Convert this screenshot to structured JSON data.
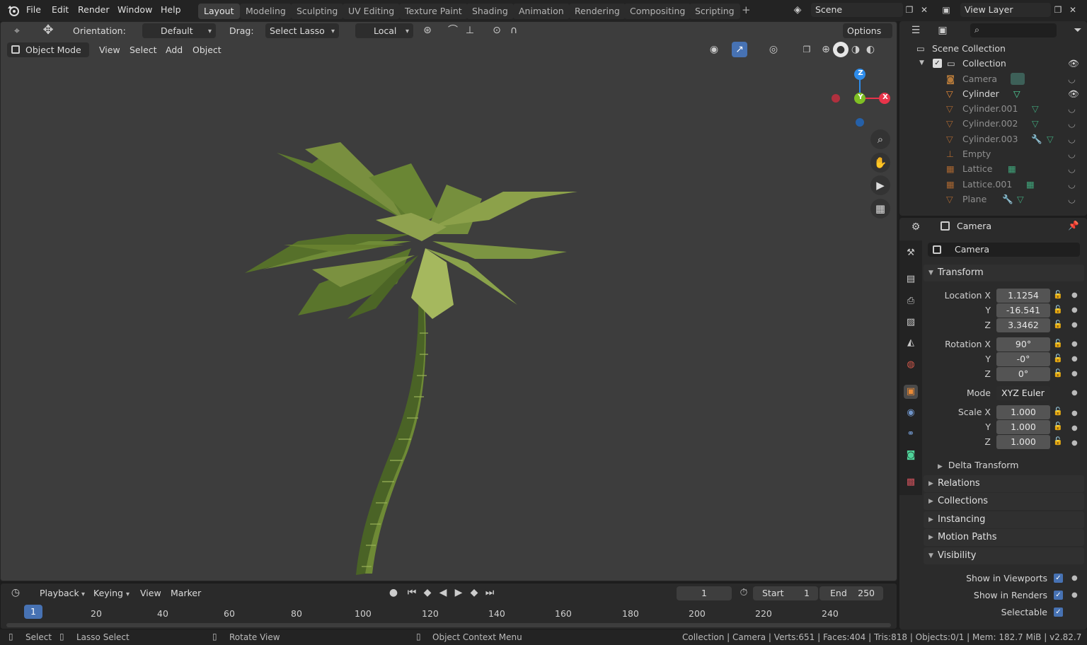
{
  "topbar": {
    "menus": [
      "File",
      "Edit",
      "Render",
      "Window",
      "Help"
    ],
    "workspaces": [
      {
        "label": "Layout",
        "active": true
      },
      {
        "label": "Modeling"
      },
      {
        "label": "Sculpting"
      },
      {
        "label": "UV Editing"
      },
      {
        "label": "Texture Paint"
      },
      {
        "label": "Shading"
      },
      {
        "label": "Animation"
      },
      {
        "label": "Rendering"
      },
      {
        "label": "Compositing"
      },
      {
        "label": "Scripting"
      }
    ],
    "add_tab": "+",
    "scene": "Scene",
    "view_layer": "View Layer"
  },
  "tool_header": {
    "orientation_label": "Orientation:",
    "orientation_value": "Default",
    "drag_label": "Drag:",
    "drag_value": "Select Lasso",
    "pivot_value": "Local",
    "options": "Options"
  },
  "viewport_header": {
    "mode": "Object Mode",
    "menus": [
      "View",
      "Select",
      "Add",
      "Object"
    ]
  },
  "gizmo": {
    "z": "Z",
    "y": "Y",
    "x": "X",
    "colors": {
      "x": "#e8344a",
      "y": "#7fbf24",
      "z": "#2d8ceb"
    }
  },
  "timeline": {
    "menus": [
      "Playback",
      "Keying",
      "View",
      "Marker"
    ],
    "current_frame": "1",
    "start_label": "Start",
    "start": "1",
    "end_label": "End",
    "end": "250",
    "ticks": [
      "20",
      "40",
      "60",
      "80",
      "100",
      "120",
      "140",
      "160",
      "180",
      "200",
      "220",
      "240"
    ],
    "playhead": "1"
  },
  "statusbar": {
    "select": "Select",
    "lasso": "Lasso Select",
    "rotate": "Rotate View",
    "context": "Object Context Menu",
    "stats": "Collection | Camera | Verts:651 | Faces:404 | Tris:818 | Objects:0/1 | Mem: 182.7 MiB | v2.82.7"
  },
  "outliner": {
    "scene_collection": "Scene Collection",
    "collection": "Collection",
    "items": [
      {
        "name": "Camera",
        "dim": true
      },
      {
        "name": "Cylinder",
        "dim": false
      },
      {
        "name": "Cylinder.001",
        "dim": true
      },
      {
        "name": "Cylinder.002",
        "dim": true
      },
      {
        "name": "Cylinder.003",
        "dim": true
      },
      {
        "name": "Empty",
        "dim": true
      },
      {
        "name": "Lattice",
        "dim": true
      },
      {
        "name": "Lattice.001",
        "dim": true
      },
      {
        "name": "Plane",
        "dim": true
      }
    ]
  },
  "properties": {
    "context": "Camera",
    "object_name": "Camera",
    "transform": {
      "title": "Transform",
      "location_label": "Location X",
      "y": "Y",
      "z": "Z",
      "location": [
        "1.1254",
        "-16.541",
        "3.3462"
      ],
      "rotation_label": "Rotation X",
      "rotation": [
        "90°",
        "-0°",
        "0°"
      ],
      "mode_label": "Mode",
      "mode": "XYZ Euler",
      "scale_label": "Scale X",
      "scale": [
        "1.000",
        "1.000",
        "1.000"
      ],
      "delta": "Delta Transform"
    },
    "panels": [
      "Relations",
      "Collections",
      "Instancing",
      "Motion Paths"
    ],
    "visibility": {
      "title": "Visibility",
      "show_viewports": "Show in Viewports",
      "show_renders": "Show in Renders",
      "selectable": "Selectable"
    }
  },
  "colors": {
    "accent": "#4772b3",
    "object_orange": "#e98a36",
    "mesh_green": "#4fd49a"
  }
}
